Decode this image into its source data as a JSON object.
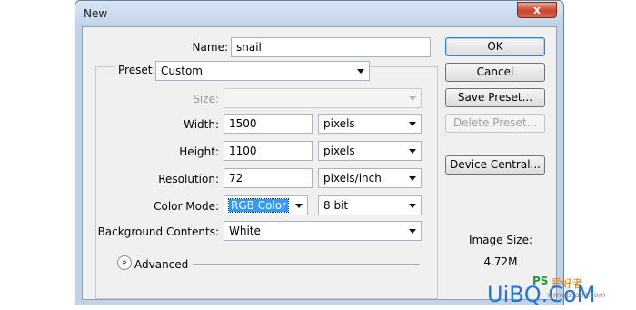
{
  "window": {
    "title": "New",
    "close_glyph": "x"
  },
  "fields": {
    "name": {
      "label": "Name:",
      "value": "snail"
    },
    "preset": {
      "label": "Preset:",
      "value": "Custom"
    },
    "size": {
      "label": "Size:",
      "value": ""
    },
    "width": {
      "label": "Width:",
      "value": "1500",
      "unit": "pixels"
    },
    "height": {
      "label": "Height:",
      "value": "1100",
      "unit": "pixels"
    },
    "resolution": {
      "label": "Resolution:",
      "value": "72",
      "unit": "pixels/inch"
    },
    "color_mode": {
      "label": "Color Mode:",
      "value": "RGB Color",
      "depth": "8 bit"
    },
    "background": {
      "label": "Background Contents:",
      "value": "White"
    }
  },
  "advanced": {
    "label": "Advanced",
    "chevron": "»"
  },
  "buttons": {
    "ok": "OK",
    "cancel": "Cancel",
    "save_preset": "Save Preset...",
    "delete_preset": "Delete Preset...",
    "device_central": "Device Central..."
  },
  "image_size": {
    "label": "Image Size:",
    "value": "4.72M"
  },
  "watermark": {
    "brand": "UiBQ.CoM",
    "ps": "PS",
    "cn": "爱好者",
    "url": "www.psahz.com"
  },
  "colors": {
    "accent": "#3399ff",
    "window_frame": "#c3d3e6",
    "close": "#c7442c"
  }
}
